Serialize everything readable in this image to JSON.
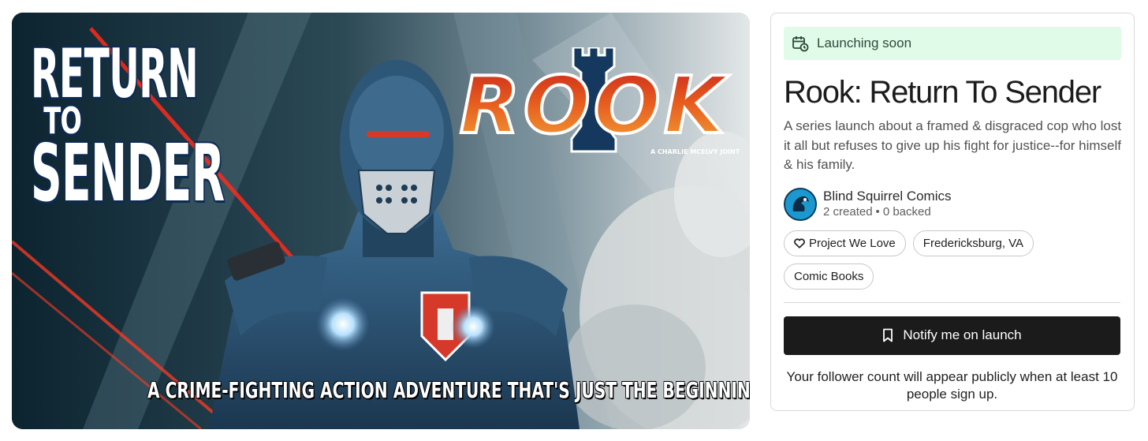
{
  "hero": {
    "title_line1": "RETURN",
    "title_to": "TO",
    "title_line2": "SENDER",
    "logo_text": "ROOK",
    "logo_credit": "A CHARLIE MCELVY JOINT",
    "tagline": "A CRIME-FIGHTING ACTION ADVENTURE THAT'S JUST THE BEGINNING..."
  },
  "status": {
    "label": "Launching soon",
    "icon": "calendar-clock-icon",
    "bg_color": "#e1fbe9"
  },
  "project": {
    "title": "Rook: Return To Sender",
    "blurb": "A series launch about a framed & disgraced cop who lost it all but refuses to give up his fight for justice--for himself & his family."
  },
  "creator": {
    "name": "Blind Squirrel Comics",
    "created": "2 created",
    "separator": "•",
    "backed": "0 backed"
  },
  "tags": [
    {
      "label": "Project We Love",
      "icon": "heart-icon"
    },
    {
      "label": "Fredericksburg, VA"
    },
    {
      "label": "Comic Books"
    }
  ],
  "cta": {
    "label": "Notify me on launch",
    "icon": "bookmark-icon",
    "bg_color": "#1b1b1b"
  },
  "notice": "Your follower count will appear publicly when at least 10 people sign up."
}
